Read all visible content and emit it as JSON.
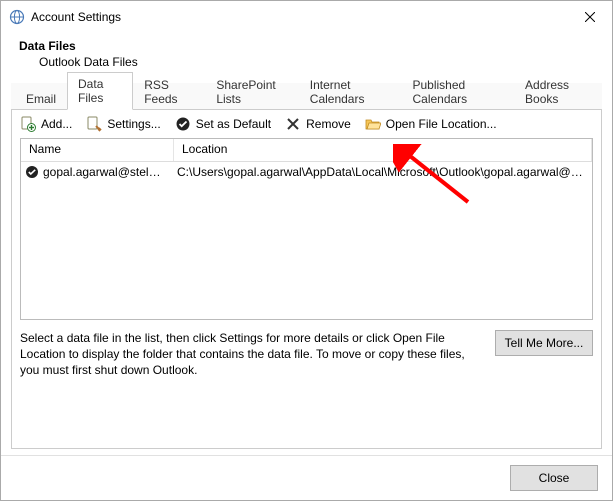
{
  "window": {
    "title": "Account Settings"
  },
  "header": {
    "title": "Data Files",
    "subtitle": "Outlook Data Files"
  },
  "tabs": [
    {
      "label": "Email",
      "active": false
    },
    {
      "label": "Data Files",
      "active": true
    },
    {
      "label": "RSS Feeds",
      "active": false
    },
    {
      "label": "SharePoint Lists",
      "active": false
    },
    {
      "label": "Internet Calendars",
      "active": false
    },
    {
      "label": "Published Calendars",
      "active": false
    },
    {
      "label": "Address Books",
      "active": false
    }
  ],
  "toolbar": {
    "add": "Add...",
    "settings": "Settings...",
    "set_default": "Set as Default",
    "remove": "Remove",
    "open_file_location": "Open File Location..."
  },
  "columns": {
    "name": "Name",
    "location": "Location"
  },
  "rows": [
    {
      "name": "gopal.agarwal@stell...",
      "location": "C:\\Users\\gopal.agarwal\\AppData\\Local\\Microsoft\\Outlook\\gopal.agarwal@st..."
    }
  ],
  "help_text": "Select a data file in the list, then click Settings for more details or click Open File Location to display the folder that contains the data file. To move or copy these files, you must first shut down Outlook.",
  "buttons": {
    "tell_me_more": "Tell Me More...",
    "close": "Close"
  }
}
